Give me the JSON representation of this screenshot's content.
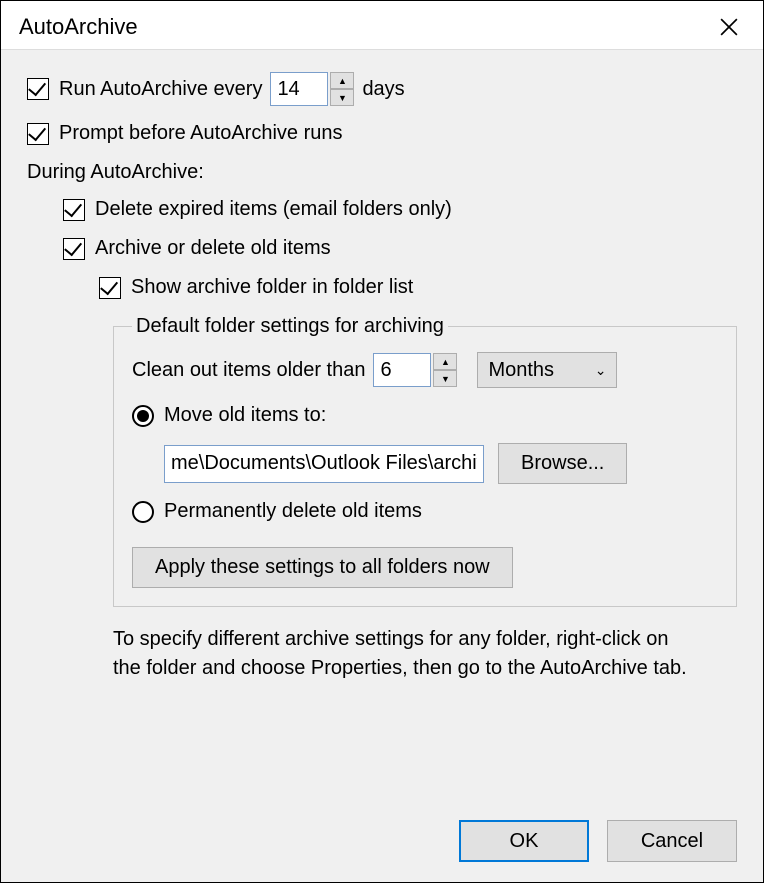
{
  "title": "AutoArchive",
  "runEvery": {
    "label_pre": "Run AutoArchive every",
    "value": "14",
    "label_post": "days",
    "checked": true
  },
  "promptBefore": {
    "label": "Prompt before AutoArchive runs",
    "checked": true
  },
  "duringLabel": "During AutoArchive:",
  "deleteExpired": {
    "label": "Delete expired items (email folders only)",
    "checked": true
  },
  "archiveDelete": {
    "label": "Archive or delete old items",
    "checked": true
  },
  "showArchiveFolder": {
    "label": "Show archive folder in folder list",
    "checked": true
  },
  "groupTitle": "Default folder settings for archiving",
  "cleanOut": {
    "label": "Clean out items older than",
    "value": "6",
    "unit": "Months"
  },
  "moveOld": {
    "label": "Move old items to:",
    "selected": true,
    "path": "me\\Documents\\Outlook Files\\archive.pst",
    "browseLabel": "Browse..."
  },
  "permDelete": {
    "label": "Permanently delete old items",
    "selected": false
  },
  "applyAllLabel": "Apply these settings to all folders now",
  "hint": "To specify different archive settings for any folder, right-click on the folder and choose Properties, then go to the AutoArchive tab.",
  "okLabel": "OK",
  "cancelLabel": "Cancel"
}
